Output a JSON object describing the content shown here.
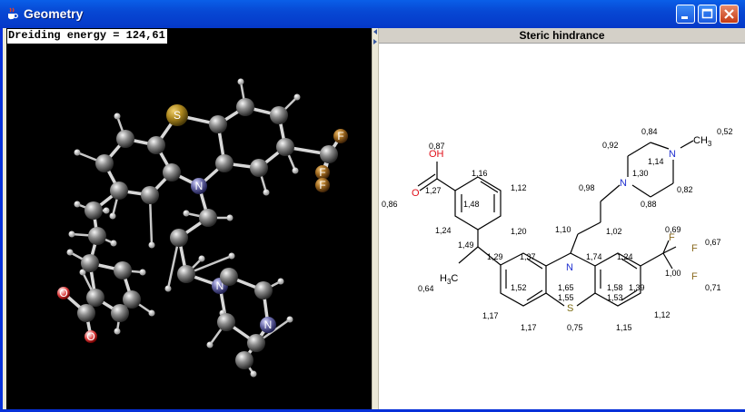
{
  "window": {
    "title": "Geometry"
  },
  "viewer3d": {
    "energy_label": "Dreiding energy = 124,61",
    "atom_labels": {
      "S": "S",
      "N": "N",
      "F": "F",
      "O": "O"
    }
  },
  "panel2d": {
    "header": "Steric hindrance",
    "atoms": {
      "OH": "OH",
      "O": "O",
      "N": "N",
      "S": "S",
      "F": "F",
      "CH3": "CH",
      "CH3_sub": "3",
      "H3C_H": "H",
      "H3C_sub": "3",
      "H3C_C": "C"
    },
    "values": {
      "v087": "0,87",
      "v127": "1,27",
      "v086": "0,86",
      "v116": "1,16",
      "v148": "1,48",
      "v112a": "1,12",
      "v124a": "1,24",
      "v120": "1,20",
      "v149": "1,49",
      "v129": "1,29",
      "v064": "0,64",
      "v137": "1,37",
      "v152": "1,52",
      "v117a": "1,17",
      "v117b": "1,17",
      "v165": "1,65",
      "v155": "1,55",
      "v075": "0,75",
      "v110": "1,10",
      "v174": "1,74",
      "v102": "1,02",
      "v098": "0,98",
      "v092": "0,92",
      "v084": "0,84",
      "v114": "1,14",
      "v130": "1,30",
      "v088": "0,88",
      "v082": "0,82",
      "v052": "0,52",
      "v124b": "1,24",
      "v158": "1,58",
      "v153": "1,53",
      "v139": "1,39",
      "v115": "1,15",
      "v112b": "1,12",
      "v069": "0,69",
      "v067": "0,67",
      "v100": "1,00",
      "v071": "0,71"
    }
  },
  "colors": {
    "titlebar": "#0748d4",
    "oxygen": "#e0101a",
    "nitrogen": "#2030d0",
    "sulfur": "#7a6a10",
    "fluorine": "#8a6a20"
  }
}
